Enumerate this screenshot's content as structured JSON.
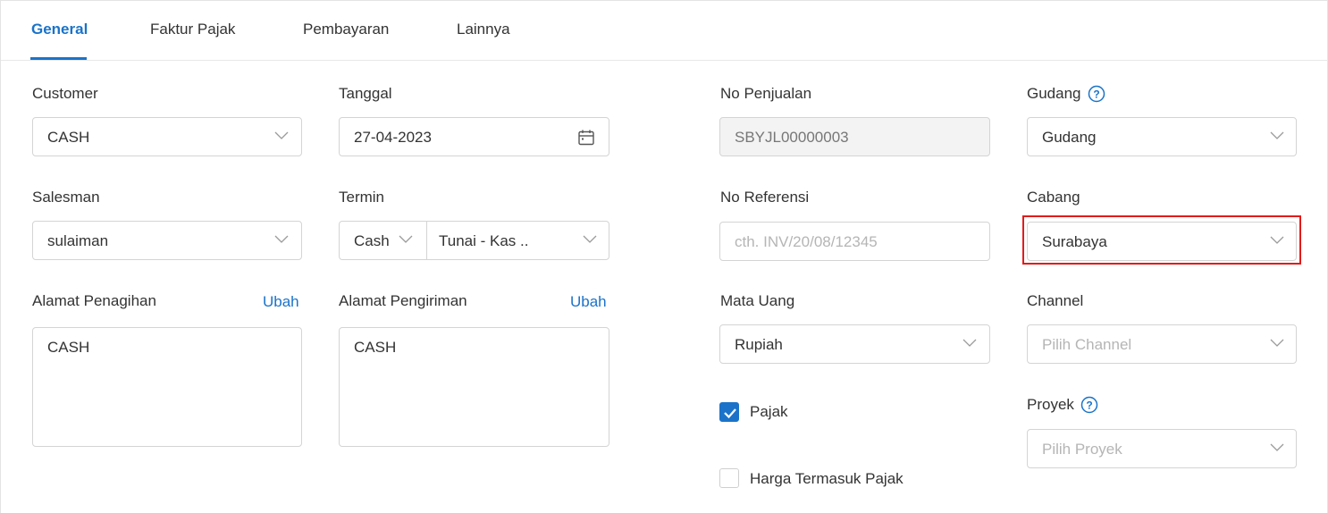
{
  "tabs": [
    {
      "label": "General"
    },
    {
      "label": "Faktur Pajak"
    },
    {
      "label": "Pembayaran"
    },
    {
      "label": "Lainnya"
    }
  ],
  "customer": {
    "label": "Customer",
    "value": "CASH"
  },
  "tanggal": {
    "label": "Tanggal",
    "value": "27-04-2023"
  },
  "no_penjualan": {
    "label": "No Penjualan",
    "value": "SBYJL00000003"
  },
  "gudang": {
    "label": "Gudang",
    "value": "Gudang"
  },
  "salesman": {
    "label": "Salesman",
    "value": "sulaiman"
  },
  "termin": {
    "label": "Termin",
    "type_value": "Cash",
    "account_value": "Tunai - Kas .."
  },
  "no_referensi": {
    "label": "No Referensi",
    "placeholder": "cth. INV/20/08/12345"
  },
  "cabang": {
    "label": "Cabang",
    "value": "Surabaya"
  },
  "alamat_penagihan": {
    "label": "Alamat Penagihan",
    "link": "Ubah",
    "value": "CASH"
  },
  "alamat_pengiriman": {
    "label": "Alamat Pengiriman",
    "link": "Ubah",
    "value": "CASH"
  },
  "mata_uang": {
    "label": "Mata Uang",
    "value": "Rupiah"
  },
  "channel": {
    "label": "Channel",
    "placeholder": "Pilih Channel"
  },
  "pajak": {
    "label": "Pajak",
    "checked": true
  },
  "harga_termasuk_pajak": {
    "label": "Harga Termasuk Pajak",
    "checked": false
  },
  "proyek": {
    "label": "Proyek",
    "placeholder": "Pilih Proyek"
  },
  "colors": {
    "accent": "#1a73c9",
    "highlight": "#e31b1b",
    "text": "#333333",
    "border": "#d4d4d4"
  }
}
